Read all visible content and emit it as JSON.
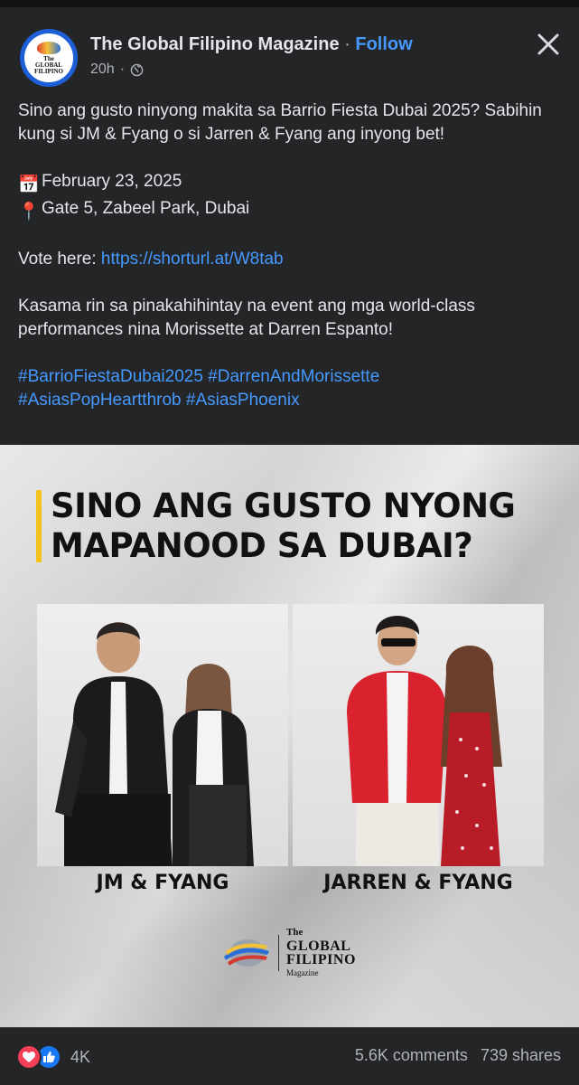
{
  "post": {
    "page_name": "The Global Filipino Magazine",
    "separator": "·",
    "follow_label": "Follow",
    "time_ago": "20h",
    "meta_dot": "·",
    "avatar_text": [
      "The",
      "GLOBAL",
      "FILIPINO",
      "Magazine"
    ],
    "text": {
      "line1": "Sino ang gusto ninyong makita sa Barrio Fiesta Dubai 2025? Sabihin kung si JM & Fyang o si Jarren & Fyang ang inyong bet!",
      "date_emoji": "📅",
      "date": "February 23, 2025",
      "pin_emoji": "📍",
      "location": "Gate 5, Zabeel Park, Dubai",
      "vote_label": "Vote here: ",
      "vote_link": "https://shorturl.at/W8tab",
      "paragraph3": "Kasama rin sa pinakahihintay na event ang mga world-class performances nina Morissette at Darren Espanto!",
      "hashtags_line1": "#BarrioFiestaDubai2025 #DarrenAndMorissette",
      "hashtags_line2": "#AsiasPopHeartthrob #AsiasPhoenix"
    }
  },
  "poster": {
    "headline": "SINO ANG GUSTO NYONG MAPANOOD SA DUBAI?",
    "left_caption": "JM & FYANG",
    "right_caption": "JARREN & FYANG",
    "logo": {
      "line1": "The",
      "line2": "GLOBAL",
      "line3": "FILIPINO",
      "line4": "Magazine"
    },
    "accent_color": "#f3c21b"
  },
  "footer": {
    "reaction_count": "4K",
    "comments": "5.6K comments",
    "shares": "739 shares"
  },
  "colors": {
    "background": "#242526",
    "link": "#4599ff",
    "text": "#e4e6eb",
    "muted": "#b0b3b8"
  }
}
